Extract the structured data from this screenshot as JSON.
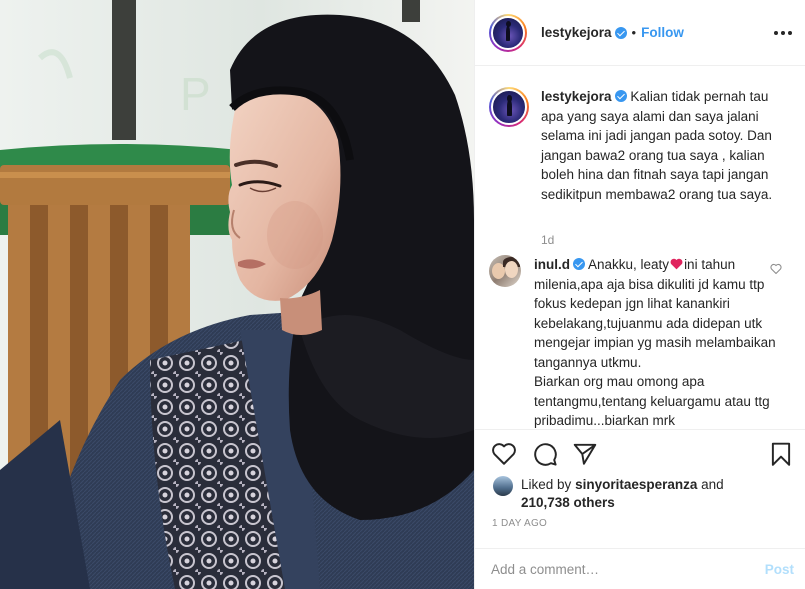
{
  "post": {
    "username": "lestykejora",
    "separator": "•",
    "follow_label": "Follow",
    "more_icon": "more-horizontal-icon",
    "photo_alt": "Woman wearing a black hijab and a denim jacket with batik panel, seated near a wooden chair"
  },
  "caption": {
    "username": "lestykejora",
    "text": "Kalian tidak pernah tau apa yang saya alami dan saya jalani selama ini jadi jangan pada sotoy. Dan jangan bawa2 orang tua saya , kalian boleh hina dan fitnah saya tapi jangan sedikitpun membawa2 orang tua saya.",
    "time": "1d"
  },
  "comments": [
    {
      "username": "inul.d",
      "text_before_emoji": "Anakku, leaty",
      "emoji": "heart",
      "text_after_emoji": "ini tahun milenia,apa aja bisa dikuliti jd kamu ttp fokus kedepan jgn lihat kanankiri kebelakang,tujuanmu ada didepan utk mengejar impian yg masih melambaikan tangannya utkmu.",
      "text_cont": "Biarkan org mau omong apa tentangmu,tentang keluargamu atau ttg pribadimu...biarkan mrk"
    }
  ],
  "actions": {
    "like_icon": "heart-outline-icon",
    "comment_icon": "comment-bubble-icon",
    "share_icon": "paper-plane-icon",
    "save_icon": "bookmark-icon"
  },
  "likes": {
    "prefix": "Liked by",
    "user": "sinyoritaesperanza",
    "and": "and",
    "count": "210,738 others"
  },
  "date": "1 DAY AGO",
  "add_comment": {
    "placeholder": "Add a comment…",
    "post_label": "Post"
  },
  "colors": {
    "link_blue": "#3897f0",
    "post_disabled": "#b2dffc",
    "muted": "#8e8e8e",
    "text": "#262626",
    "border": "#efefef"
  }
}
